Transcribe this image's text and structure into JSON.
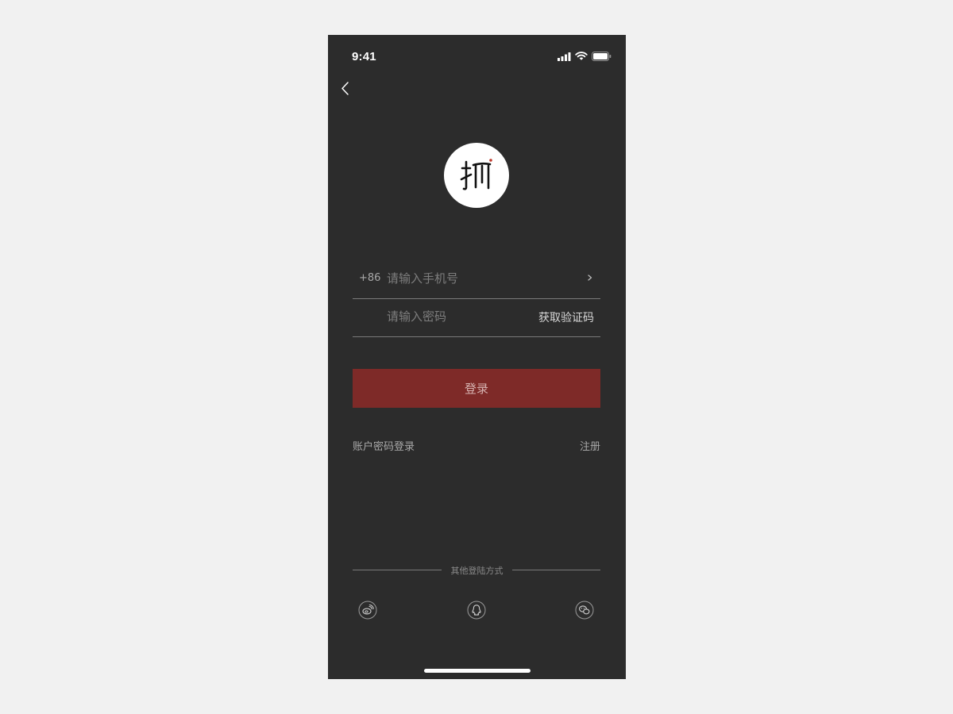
{
  "status_bar": {
    "time": "9:41",
    "icons": [
      "signal-icon",
      "wifi-icon",
      "battery-icon"
    ]
  },
  "nav": {
    "back_icon": "chevron-left-icon"
  },
  "logo": {
    "glyph": "抓",
    "accent": "#c0392b"
  },
  "phone_field": {
    "country_code": "+86",
    "placeholder": "请输入手机号",
    "value": "",
    "chevron_icon": "chevron-right-icon"
  },
  "password_field": {
    "placeholder": "请输入密码",
    "value": "",
    "code_button": "获取验证码"
  },
  "login_button": {
    "label": "登录",
    "color": "#7e2a28"
  },
  "links": {
    "account_login": "账户密码登录",
    "register": "注册"
  },
  "other_login": {
    "label": "其他登陆方式",
    "icons": [
      "weibo-icon",
      "qq-icon",
      "wechat-icon"
    ]
  },
  "colors": {
    "background": "#2c2c2c",
    "page": "#f1f1f1"
  }
}
